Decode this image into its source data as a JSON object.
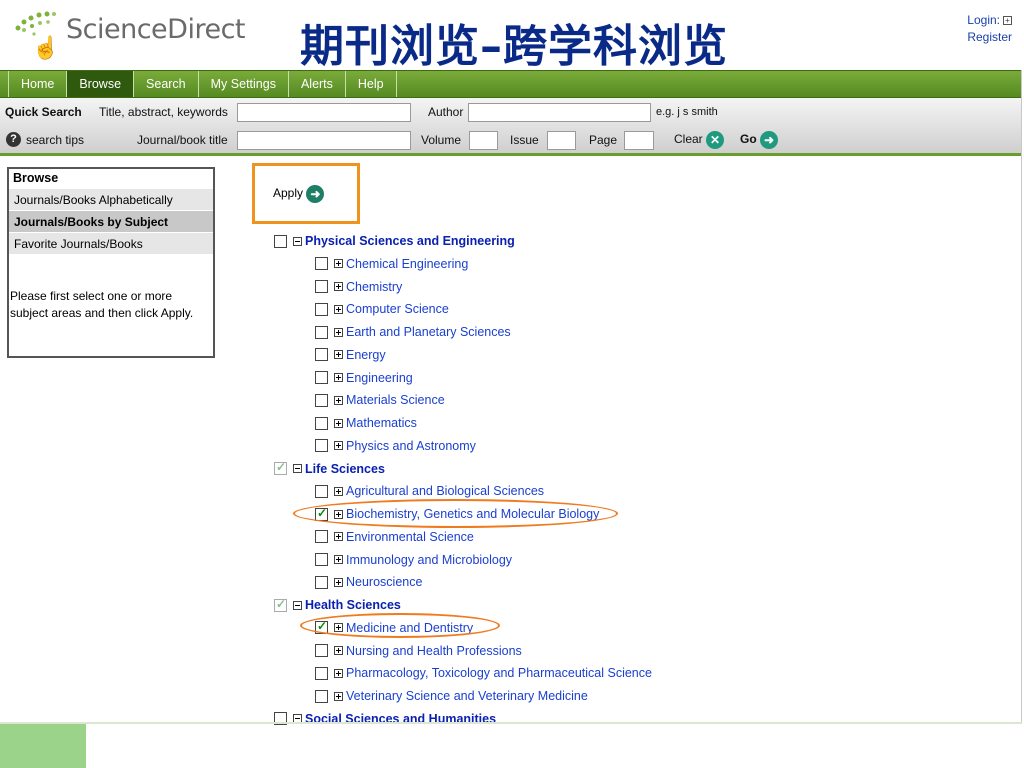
{
  "header": {
    "logo_text": "ScienceDirect",
    "slide_title": "期刊浏览–跨学科浏览",
    "login_label": "Login:",
    "register_label": "Register"
  },
  "nav": {
    "tabs": [
      "Home",
      "Browse",
      "Search",
      "My Settings",
      "Alerts",
      "Help"
    ],
    "active_tab": "Browse"
  },
  "quick_search": {
    "title": "Quick Search",
    "tips_label": "search tips",
    "field1_label": "Title, abstract, keywords",
    "field1_value": "",
    "author_label": "Author",
    "author_value": "",
    "author_hint": "e.g. j s smith",
    "field2_label": "Journal/book title",
    "field2_value": "",
    "volume_label": "Volume",
    "issue_label": "Issue",
    "page_label": "Page",
    "clear_label": "Clear",
    "go_label": "Go"
  },
  "browse_panel": {
    "heading": "Browse",
    "items": [
      "Journals/Books Alphabetically",
      "Journals/Books by Subject",
      "Favorite Journals/Books"
    ],
    "active_item": "Journals/Books by Subject",
    "note": "Please first select one or more subject areas and then click Apply."
  },
  "apply_label": "Apply",
  "subjects": [
    {
      "label": "Physical Sciences and Engineering",
      "checked": false,
      "children": [
        {
          "label": "Chemical Engineering",
          "checked": false
        },
        {
          "label": "Chemistry",
          "checked": false
        },
        {
          "label": "Computer Science",
          "checked": false
        },
        {
          "label": "Earth and Planetary Sciences",
          "checked": false
        },
        {
          "label": "Energy",
          "checked": false
        },
        {
          "label": "Engineering",
          "checked": false
        },
        {
          "label": "Materials Science",
          "checked": false
        },
        {
          "label": "Mathematics",
          "checked": false
        },
        {
          "label": "Physics and Astronomy",
          "checked": false
        }
      ]
    },
    {
      "label": "Life Sciences",
      "checked": "partial",
      "children": [
        {
          "label": "Agricultural and Biological Sciences",
          "checked": false
        },
        {
          "label": "Biochemistry, Genetics and Molecular Biology",
          "checked": true
        },
        {
          "label": "Environmental Science",
          "checked": false
        },
        {
          "label": "Immunology and Microbiology",
          "checked": false
        },
        {
          "label": "Neuroscience",
          "checked": false
        }
      ]
    },
    {
      "label": "Health Sciences",
      "checked": "partial",
      "children": [
        {
          "label": "Medicine and Dentistry",
          "checked": true
        },
        {
          "label": "Nursing and Health Professions",
          "checked": false
        },
        {
          "label": "Pharmacology, Toxicology and Pharmaceutical Science",
          "checked": false
        },
        {
          "label": "Veterinary Science and Veterinary Medicine",
          "checked": false
        }
      ]
    },
    {
      "label": "Social Sciences and Humanities",
      "checked": false,
      "children": []
    }
  ],
  "colors": {
    "nav_green": "#558a22",
    "link_blue": "#1a3fd0",
    "title_blue": "#0a2a88",
    "highlight_orange": "#f0921e"
  }
}
